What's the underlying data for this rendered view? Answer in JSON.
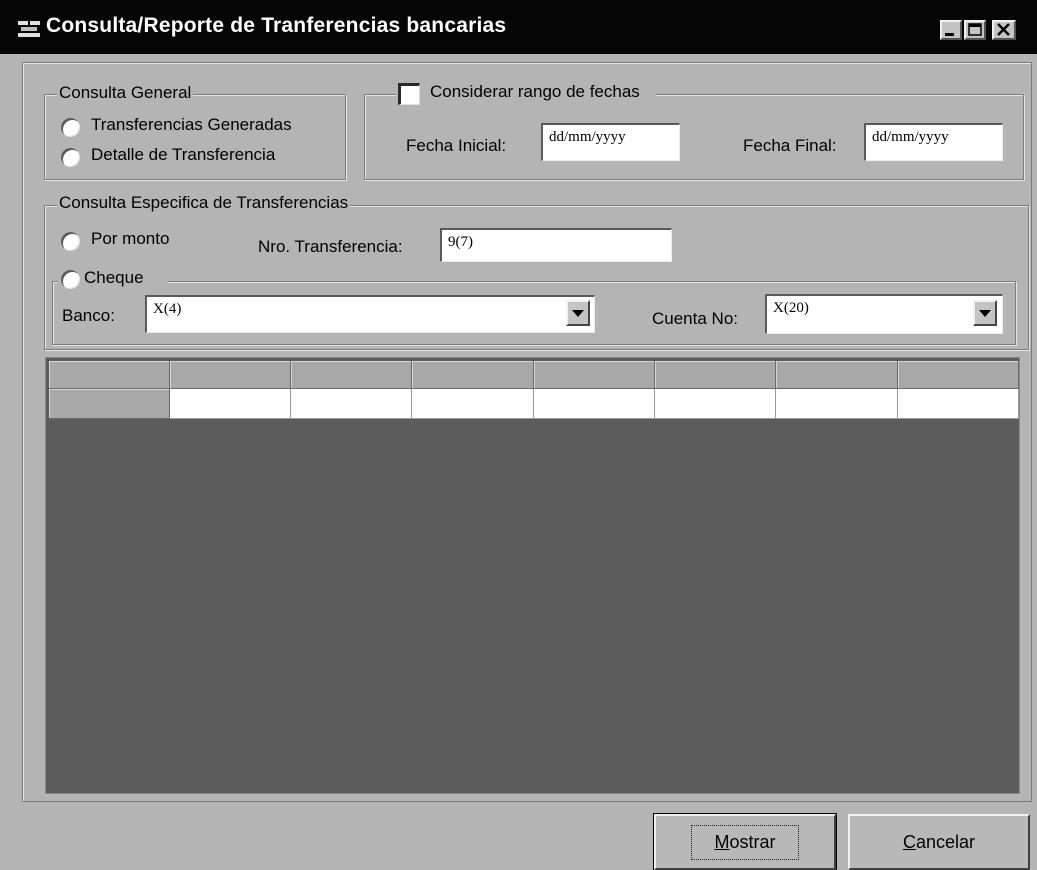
{
  "window": {
    "title": "Consulta/Reporte de Tranferencias bancarias",
    "controls": [
      "minimize-icon",
      "maximize-icon",
      "close-icon"
    ]
  },
  "general": {
    "legend": "Consulta General",
    "options": [
      "Transferencias Generadas",
      "Detalle de Transferencia"
    ]
  },
  "dates": {
    "checkbox_label": "Considerar rango de fechas",
    "start_label": "Fecha Inicial:",
    "start_value": "dd/mm/yyyy",
    "end_label": "Fecha Final:",
    "end_value": "dd/mm/yyyy"
  },
  "specific": {
    "legend": "Consulta Especifica de Transferencias",
    "por_monto": "Por monto",
    "nro_label": "Nro. Transferencia:",
    "nro_value": "9(7)",
    "cheque": "Cheque",
    "banco_label": "Banco:",
    "banco_value": "X(4)",
    "cuenta_label": "Cuenta No:",
    "cuenta_value": "X(20)"
  },
  "buttons": {
    "mostrar": "Mostrar",
    "cancelar": "Cancelar"
  },
  "colors": {
    "titlebar": "#050505",
    "window_bg": "#b4b4b4",
    "grid_bg": "#5c5c5c"
  }
}
